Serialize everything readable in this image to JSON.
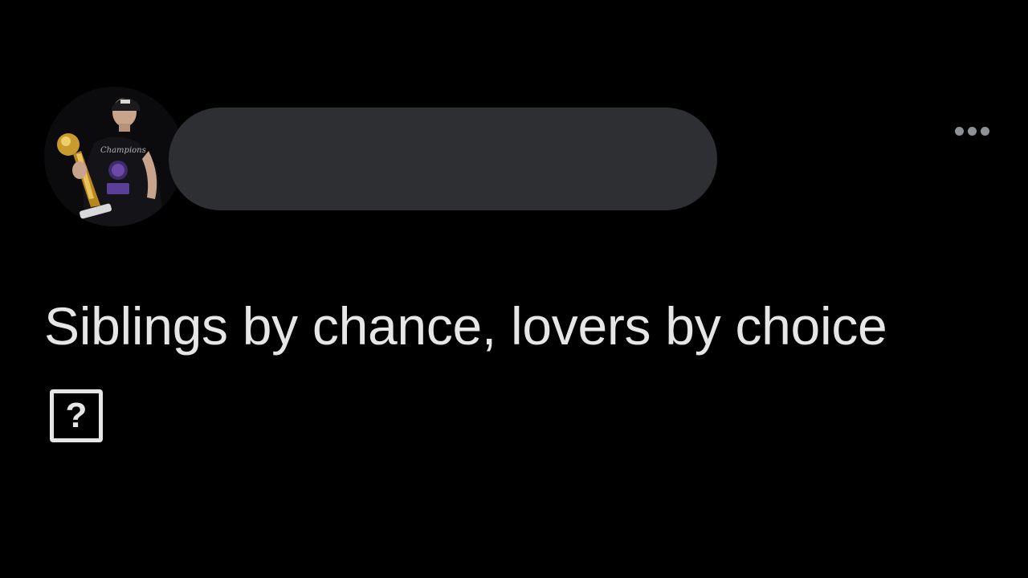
{
  "post": {
    "text": "Siblings by chance, lovers by choice",
    "emoji_placeholder": "?"
  },
  "header": {
    "avatar_icon": "profile-photo-icon",
    "name_redacted": true,
    "more_options_icon": "more-horizontal-icon"
  },
  "colors": {
    "background": "#000000",
    "text": "#e6e6e6",
    "redaction": "#2d2f33",
    "icon": "#8e9196"
  }
}
